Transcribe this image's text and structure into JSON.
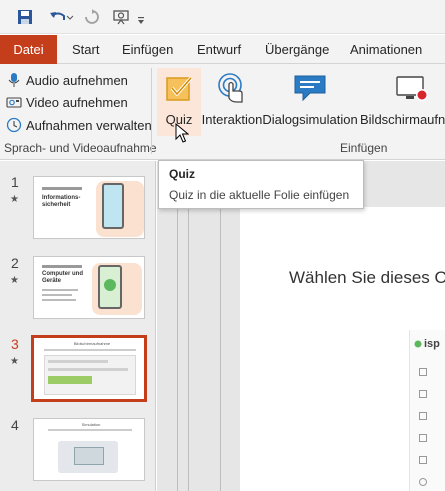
{
  "qat": {
    "save_icon": "save-icon",
    "undo_icon": "undo-icon",
    "redo_icon": "redo-icon",
    "present_icon": "present-from-start-icon",
    "customize_icon": "customize-toolbar-icon"
  },
  "tabs": [
    "Datei",
    "Start",
    "Einfügen",
    "Entwurf",
    "Übergänge",
    "Animationen"
  ],
  "ribbon": {
    "record_group": {
      "items": [
        "Audio aufnehmen",
        "Video aufnehmen",
        "Aufnahmen verwalten"
      ],
      "label": "Sprach- und Videoaufnahme"
    },
    "insert_group": {
      "buttons": [
        "Quiz",
        "Interaktion",
        "Dialogsimulation",
        "Bildschirmaufna"
      ],
      "label": "Einfügen"
    }
  },
  "tooltip": {
    "title": "Quiz",
    "description": "Quiz in die aktuelle Folie einfügen"
  },
  "slides": {
    "numbers": [
      "1",
      "2",
      "3",
      "4"
    ],
    "star": "★",
    "thumb1_title": "Informations-sicherheit",
    "thumb2_title": "Computer und Geräte",
    "thumb3_title": "Bildschirmaufnahme",
    "thumb4_title": "Simulation"
  },
  "editor": {
    "slide_text": "Wählen Sie dieses O",
    "screenshot_logo": "isp"
  },
  "colors": {
    "accent": "#c43e1c",
    "quiz_highlight": "#fbe6d9",
    "ribbon_bg": "#f3f3f3",
    "icon_blue": "#2b7bc4"
  }
}
